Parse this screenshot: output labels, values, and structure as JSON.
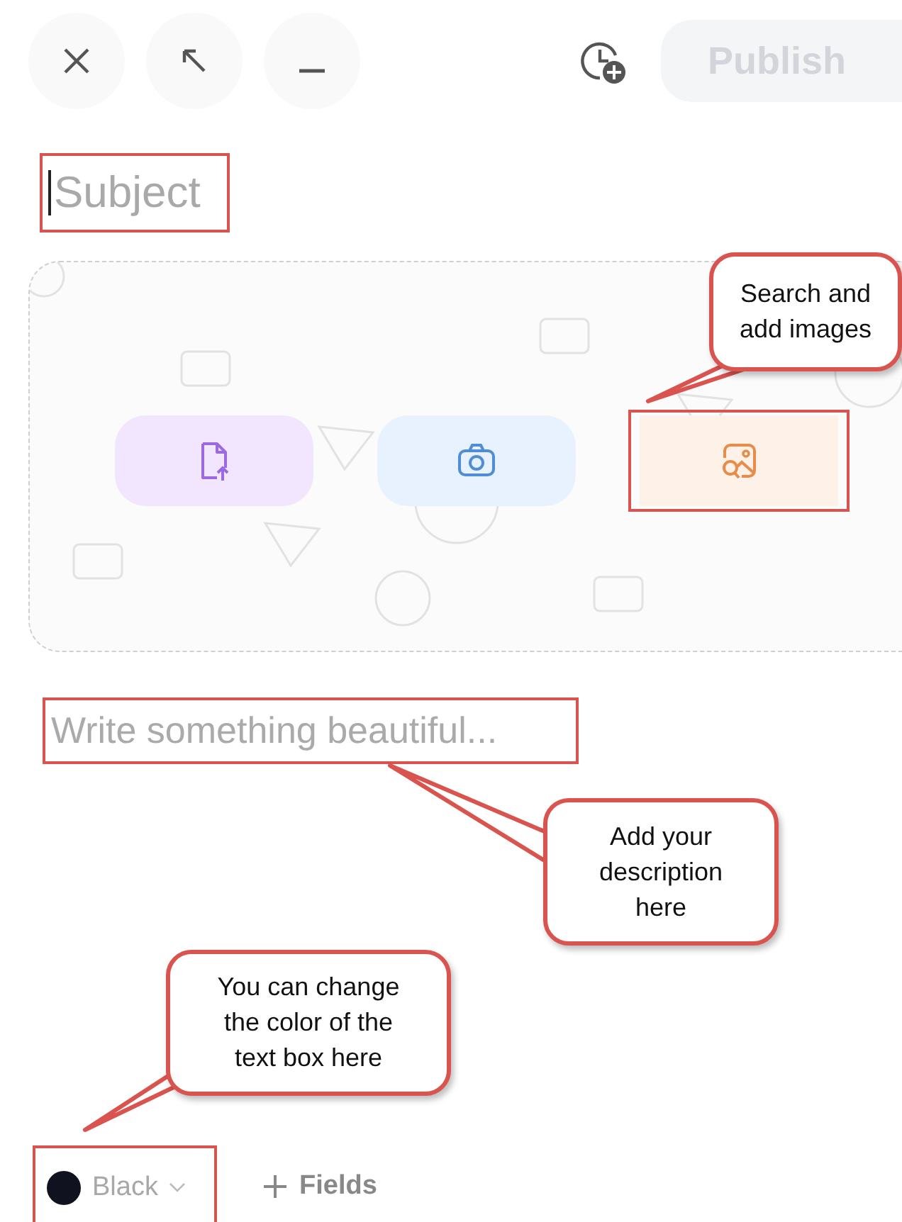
{
  "toolbar": {
    "window_buttons": [
      {
        "kind": "close"
      },
      {
        "kind": "expand"
      },
      {
        "kind": "minimize"
      }
    ],
    "schedule": {
      "kind": "clock-plus"
    },
    "publish": {
      "label": "Publish",
      "disabled": true
    }
  },
  "subject": {
    "placeholder": "Subject",
    "focused": true,
    "highlighted": true
  },
  "media": {
    "buttons": [
      {
        "kind": "upload",
        "highlighted": false
      },
      {
        "kind": "camera",
        "highlighted": false
      },
      {
        "kind": "image-search",
        "highlighted": true
      }
    ]
  },
  "description": {
    "placeholder": "Write something beautiful...",
    "highlighted": true
  },
  "footer": {
    "color_picker": {
      "label": "Black",
      "color": "#10121f",
      "highlighted": true
    },
    "fields_button": {
      "label": "Fields"
    }
  },
  "callouts": [
    {
      "lines": [
        "Search and",
        "add images"
      ]
    },
    {
      "lines": [
        "Add your",
        "description",
        "here"
      ]
    },
    {
      "lines": [
        "You can change",
        "the color of the",
        "text box here"
      ]
    }
  ]
}
